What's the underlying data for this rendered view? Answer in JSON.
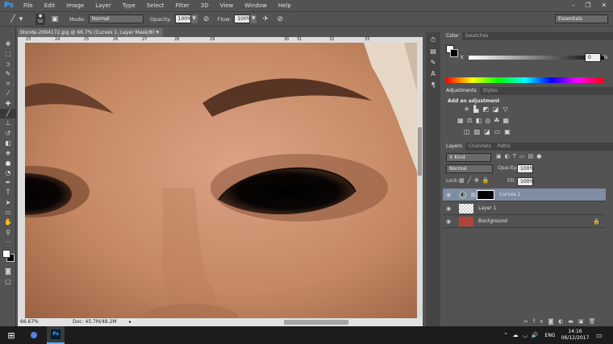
{
  "app": {
    "logo": "Ps"
  },
  "menu": [
    "File",
    "Edit",
    "Image",
    "Layer",
    "Type",
    "Select",
    "Filter",
    "3D",
    "View",
    "Window",
    "Help"
  ],
  "options": {
    "brush_size": "50",
    "mode_label": "Mode:",
    "mode_value": "Normal",
    "opacity_label": "Opacity:",
    "opacity_value": "100%",
    "flow_label": "Flow:",
    "flow_value": "100%",
    "workspace": "Essentials"
  },
  "document": {
    "tab_title": "blonde-2094172.jpg @ 66.7% (Curves 1, Layer Mask/8) *",
    "ruler_ticks": [
      "23",
      "24",
      "25",
      "26",
      "27",
      "28",
      "29",
      "30",
      "31",
      "32",
      "33"
    ],
    "zoom": "66.67%",
    "doc_info": "Doc: 45.7M/48.2M"
  },
  "panels": {
    "color_tabs": [
      "Color",
      "Swatches"
    ],
    "color_value": "0",
    "adjust_tabs": [
      "Adjustments",
      "Styles"
    ],
    "adjust_title": "Add an adjustment",
    "layers_tabs": [
      "Layers",
      "Channels",
      "Paths"
    ],
    "kind_label": "Kind",
    "blend_mode": "Normal",
    "opacity_label": "Opacity:",
    "opacity_value": "100%",
    "lock_label": "Lock:",
    "fill_label": "Fill:",
    "fill_value": "100%",
    "layers": [
      {
        "name": "Curves 1",
        "selected": true
      },
      {
        "name": "Layer 1",
        "selected": false
      },
      {
        "name": "Background",
        "selected": false
      }
    ]
  },
  "taskbar": {
    "language": "ENG",
    "time": "14:16",
    "date": "06/12/2017"
  },
  "colors": {
    "accent": "#31a8ff",
    "selected_layer": "#7f8da3",
    "skin": "#c8926f"
  }
}
